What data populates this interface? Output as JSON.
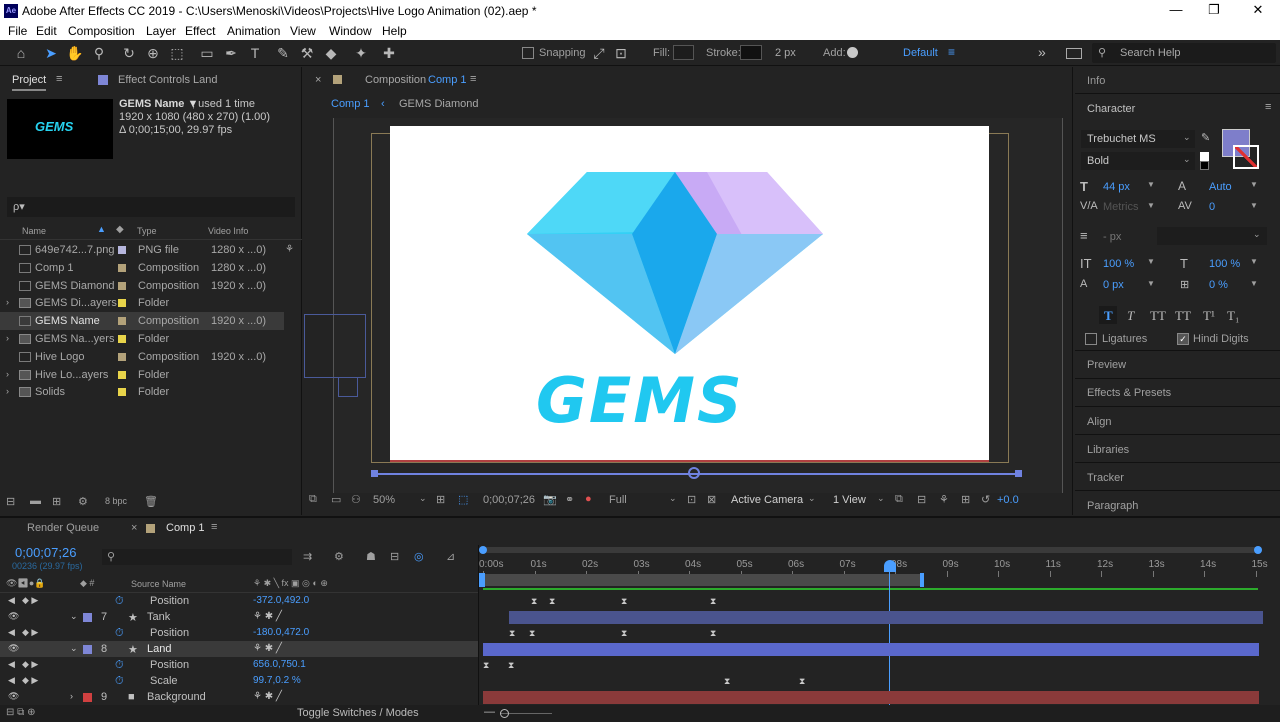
{
  "title": "Adobe After Effects CC 2019 - C:\\Users\\Menoski\\Videos\\Projects\\Hive Logo Animation (02).aep *",
  "ae_badge": "Ae",
  "win_controls": {
    "min": "—",
    "max": "❐",
    "close": "✕"
  },
  "menu": [
    "File",
    "Edit",
    "Composition",
    "Layer",
    "Effect",
    "Animation",
    "View",
    "Window",
    "Help"
  ],
  "toolbar": {
    "snapping": "Snapping",
    "fill": "Fill:",
    "stroke": "Stroke:",
    "stroke_px": "2 px",
    "add": "Add:",
    "workspace": "Default",
    "search": "Search Help"
  },
  "project": {
    "tab": "Project",
    "effect_controls": "Effect Controls Land",
    "thumb_text": "GEMS",
    "item_name": "GEMS Name ▼",
    "used": ", used 1 time",
    "dims": "1920 x 1080  (480 x 270) (1.00)",
    "duration": "Δ 0;00;15;00, 29.97 fps",
    "search_placeholder": "ρ▾",
    "headers": {
      "name": "Name",
      "type": "Type",
      "video": "Video Info"
    },
    "items": [
      {
        "name": "649e742...7.png",
        "type": "PNG file",
        "info": "1280 x ...0)",
        "color": "#b6b6dd"
      },
      {
        "name": "Comp 1",
        "type": "Composition",
        "info": "1280 x ...0)",
        "color": "#b3a27a"
      },
      {
        "name": "GEMS Diamond",
        "type": "Composition",
        "info": "1920 x ...0)",
        "color": "#b3a27a"
      },
      {
        "name": "GEMS Di...ayers",
        "type": "Folder",
        "info": "",
        "color": "#e8d44a"
      },
      {
        "name": "GEMS Name",
        "type": "Composition",
        "info": "1920 x ...0)",
        "color": "#b3a27a"
      },
      {
        "name": "GEMS Na...yers",
        "type": "Folder",
        "info": "",
        "color": "#e8d44a"
      },
      {
        "name": "Hive Logo",
        "type": "Composition",
        "info": "1920 x ...0)",
        "color": "#b3a27a"
      },
      {
        "name": "Hive Lo...ayers",
        "type": "Folder",
        "info": "",
        "color": "#e8d44a"
      },
      {
        "name": "Solids",
        "type": "Folder",
        "info": "",
        "color": "#e8d44a"
      }
    ],
    "bpc": "8 bpc"
  },
  "comp": {
    "tab": "Composition",
    "tab_name": "Comp 1",
    "crumb1": "Comp 1",
    "crumb2": "GEMS Diamond",
    "logo_text": "GEMS",
    "zoom": "50%",
    "timecode": "0;00;07;26",
    "quality": "Full",
    "camera": "Active Camera",
    "view": "1 View",
    "exposure": "+0.0"
  },
  "right": {
    "info": "Info",
    "character": "Character",
    "font": "Trebuchet MS",
    "style": "Bold",
    "size": "44 px",
    "leading": "Auto",
    "kerning": "Metrics",
    "tracking": "0",
    "stroke_w": "- px",
    "vscale": "100 %",
    "hscale": "100 %",
    "baseline": "0 px",
    "tsume": "0 %",
    "fmt_buttons": [
      "T",
      "T",
      "TT",
      "TT",
      "T¹",
      "T₁"
    ],
    "ligatures": "Ligatures",
    "hindi": "Hindi Digits",
    "panels": [
      "Preview",
      "Effects & Presets",
      "Align",
      "Libraries",
      "Tracker",
      "Paragraph"
    ]
  },
  "timeline": {
    "render_queue": "Render Queue",
    "comp_tab": "Comp 1",
    "timecode": "0;00;07;26",
    "fps": "00236 (29.97 fps)",
    "source_name": "Source Name",
    "toggle": "Toggle Switches / Modes",
    "ticks": [
      "0:00s",
      "01s",
      "02s",
      "03s",
      "04s",
      "05s",
      "06s",
      "07s",
      "08s",
      "09s",
      "10s",
      "11s",
      "12s",
      "13s",
      "14s",
      "15s"
    ],
    "rows": [
      {
        "kind": "prop",
        "name": "Position",
        "value": "-372.0,492.0"
      },
      {
        "kind": "layer",
        "num": "7",
        "name": "Tank",
        "color": "#7e86d6"
      },
      {
        "kind": "prop",
        "name": "Position",
        "value": "-180.0,472.0"
      },
      {
        "kind": "layer",
        "num": "8",
        "name": "Land",
        "color": "#7e86d6"
      },
      {
        "kind": "prop",
        "name": "Position",
        "value": "656.0,750.1"
      },
      {
        "kind": "prop",
        "name": "Scale",
        "value": "99.7,0.2 %"
      },
      {
        "kind": "layer",
        "num": "9",
        "name": "Background",
        "color": "#d04040"
      }
    ]
  }
}
